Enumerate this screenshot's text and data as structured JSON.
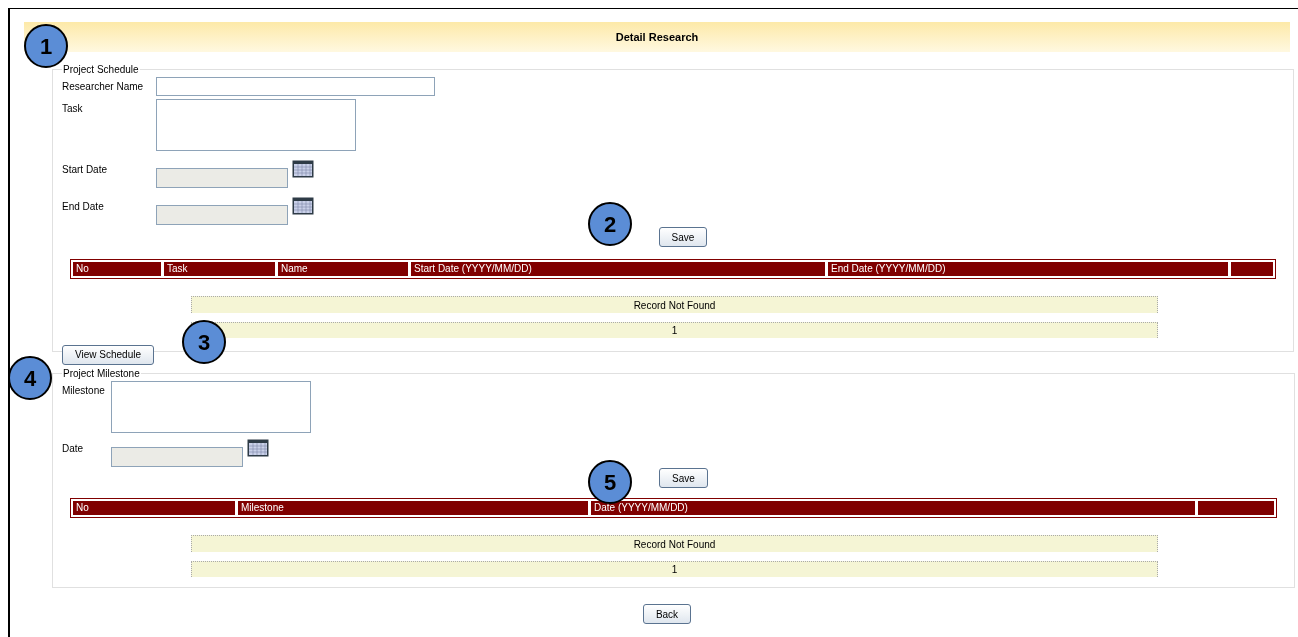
{
  "header": {
    "title": "Detail Research"
  },
  "callouts": [
    "1",
    "2",
    "3",
    "4",
    "5"
  ],
  "schedule": {
    "legend": "Project Schedule",
    "fields": [
      {
        "label": "Researcher Name",
        "kind": "text"
      },
      {
        "label": "Task",
        "kind": "textarea"
      },
      {
        "label": "Start Date",
        "kind": "date"
      },
      {
        "label": "End Date",
        "kind": "date"
      }
    ],
    "save_button": "Save",
    "columns": [
      "No",
      "Task",
      "Name",
      "Start Date (YYYY/MM/DD)",
      "End Date (YYYY/MM/DD)",
      ""
    ],
    "empty_message": "Record Not Found",
    "pager": "1",
    "view_button": "View Schedule"
  },
  "milestone": {
    "legend": "Project Milestone",
    "fields": [
      {
        "label": "Milestone",
        "kind": "textarea"
      },
      {
        "label": "Date",
        "kind": "date"
      }
    ],
    "save_button": "Save",
    "columns": [
      "No",
      "Milestone",
      "Date (YYYY/MM/DD)",
      ""
    ],
    "empty_message": "Record Not Found",
    "pager": "1"
  },
  "back_button": "Back"
}
